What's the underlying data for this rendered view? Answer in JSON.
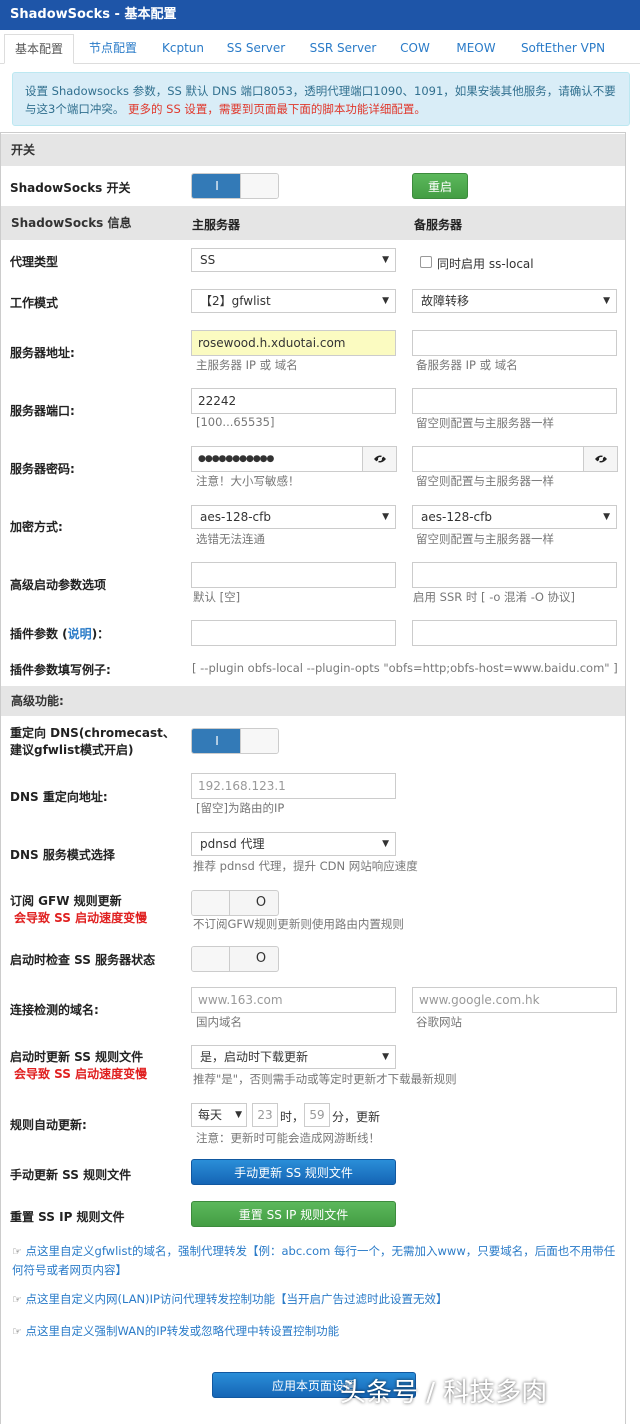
{
  "title": "ShadowSocks - 基本配置",
  "tabs": [
    "基本配置",
    "节点配置",
    "Kcptun",
    "SS Server",
    "SSR Server",
    "COW",
    "MEOW",
    "SoftEther VPN"
  ],
  "notice": {
    "text": "设置 Shadowsocks 参数，SS 默认 DNS 端口8053，透明代理端口1090、1091，如果安装其他服务，请确认不要与这3个端口冲突。",
    "red": "更多的 SS 设置，需要到页面最下面的脚本功能详细配置。"
  },
  "sections": {
    "switch": "开关",
    "advanced": "高级功能:"
  },
  "ss_switch": {
    "label": "ShadowSocks 开关",
    "toggle_text": "I",
    "restart": "重启"
  },
  "info": {
    "label": "ShadowSocks 信息",
    "main": "主服务器",
    "backup": "备服务器"
  },
  "proxy_type": {
    "label": "代理类型",
    "value": "SS",
    "checkbox": "同时启用 ss-local"
  },
  "work_mode": {
    "label": "工作模式",
    "main": "【2】gfwlist",
    "backup": "故障转移"
  },
  "server_addr": {
    "label": "服务器地址:",
    "main": "rosewood.h.xduotai.com",
    "main_help": "主服务器 IP 或 域名",
    "backup_help": "备服务器 IP 或 域名"
  },
  "server_port": {
    "label": "服务器端口:",
    "main": "22242",
    "main_help": "[100...65535]",
    "backup_help": "留空则配置与主服务器一样"
  },
  "server_pass": {
    "label": "服务器密码:",
    "main": "●●●●●●●●●●●",
    "main_help": "注意！大小写敏感！",
    "backup_help": "留空则配置与主服务器一样"
  },
  "encryption": {
    "label": "加密方式:",
    "main": "aes-128-cfb",
    "backup": "aes-128-cfb",
    "main_help": "选错无法连通",
    "backup_help": "留空则配置与主服务器一样"
  },
  "adv_params": {
    "label": "高级启动参数选项",
    "main_help": "默认 [空]",
    "backup_help": "启用 SSR 时 [ -o 混淆 -O 协议]"
  },
  "plugin": {
    "label_pre": "插件参数 (",
    "label_link": "说明",
    "label_post": ")："
  },
  "plugin_example": {
    "label": "插件参数填写例子:",
    "text": "[ --plugin obfs-local --plugin-opts \"obfs=http;obfs-host=www.baidu.com\" ]"
  },
  "dns_redirect": {
    "label": "重定向 DNS(chromecast、建议gfwlist模式开启)",
    "toggle_text": "I"
  },
  "dns_addr": {
    "label": "DNS 重定向地址:",
    "value": "192.168.123.1",
    "help": "[留空]为路由的IP"
  },
  "dns_mode": {
    "label": "DNS 服务模式选择",
    "value": "pdnsd 代理",
    "help": "推荐 pdnsd 代理，提升 CDN 网站响应速度"
  },
  "gfw_update": {
    "label": "订阅 GFW 规则更新",
    "warn": "会导致 SS 启动速度变慢",
    "help": "不订阅GFW规则更新则使用路由内置规则",
    "toggle_text": "O"
  },
  "check_server": {
    "label": "启动时检查 SS 服务器状态",
    "toggle_text": "O"
  },
  "check_domain": {
    "label": "连接检测的域名:",
    "main": "www.163.com",
    "backup": "www.google.com.hk",
    "main_help": "国内域名",
    "backup_help": "谷歌网站"
  },
  "boot_update": {
    "label": "启动时更新 SS 规则文件",
    "warn": "会导致 SS 启动速度变慢",
    "value": "是，启动时下载更新",
    "help": "推荐\"是\"，否则需手动或等定时更新才下载最新规则"
  },
  "auto_update": {
    "label": "规则自动更新:",
    "freq": "每天",
    "hour": "23",
    "hour_unit": "时，",
    "minute": "59",
    "minute_unit": "分，更新",
    "help": "注意：更新时可能会造成网游断线！"
  },
  "manual_update": {
    "label": "手动更新 SS 规则文件",
    "button": "手动更新 SS 规则文件"
  },
  "reset_ip": {
    "label": "重置 SS IP 规则文件",
    "button": "重置 SS IP 规则文件"
  },
  "links": [
    "点这里自定义gfwlist的域名，强制代理转发【例：abc.com 每行一个，无需加入www，只要域名，后面也不用带任何符号或者网页内容】",
    "点这里自定义内网(LAN)IP访问代理转发控制功能【当开启广告过滤时此设置无效】",
    "点这里自定义强制WAN的IP转发或忽略代理中转设置控制功能"
  ],
  "apply": "应用本页面设置",
  "watermark": "头条号 / 科技多肉",
  "icons": {
    "select_arrow": "▼",
    "eye": "eye-icon",
    "hand": "hand-pointer-icon"
  }
}
